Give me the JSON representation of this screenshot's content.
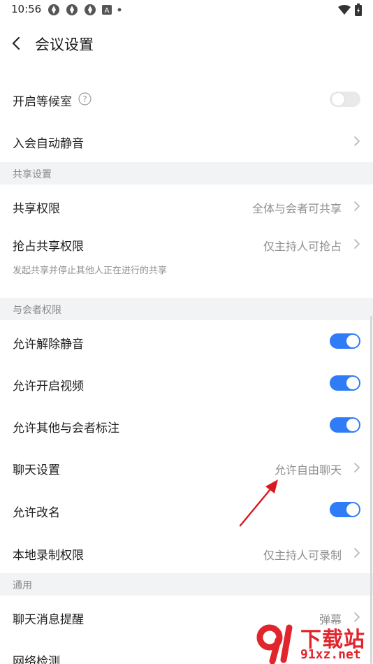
{
  "status_bar": {
    "time": "10:56",
    "badge": "A"
  },
  "header": {
    "title": "会议设置"
  },
  "rows": {
    "waiting_room": {
      "label": "开启等候室",
      "toggle_on": false
    },
    "auto_mute": {
      "label": "入会自动静音"
    },
    "share_permission": {
      "label": "共享权限",
      "value": "全体与会者可共享"
    },
    "grab_share": {
      "label": "抢占共享权限",
      "value": "仅主持人可抢占",
      "hint": "发起共享并停止其他人正在进行的共享"
    },
    "allow_unmute": {
      "label": "允许解除静音",
      "toggle_on": true
    },
    "allow_video": {
      "label": "允许开启视频",
      "toggle_on": true
    },
    "allow_annotate": {
      "label": "允许其他与会者标注",
      "toggle_on": true
    },
    "chat_settings": {
      "label": "聊天设置",
      "value": "允许自由聊天"
    },
    "allow_rename": {
      "label": "允许改名",
      "toggle_on": true
    },
    "local_record": {
      "label": "本地录制权限",
      "value": "仅主持人可录制"
    },
    "chat_reminder": {
      "label": "聊天消息提醒",
      "value": "弹幕"
    },
    "network_check": {
      "label": "网络检测"
    }
  },
  "sections": {
    "share": "共享设置",
    "participant": "与会者权限",
    "general": "通用"
  },
  "watermark": {
    "cn": "下载站",
    "url": "91xz.net"
  },
  "colors": {
    "accent": "#2f7cf6",
    "section_bg": "#f2f3f5",
    "annotation_arrow": "#d9191f",
    "watermark": "#e2242c"
  }
}
